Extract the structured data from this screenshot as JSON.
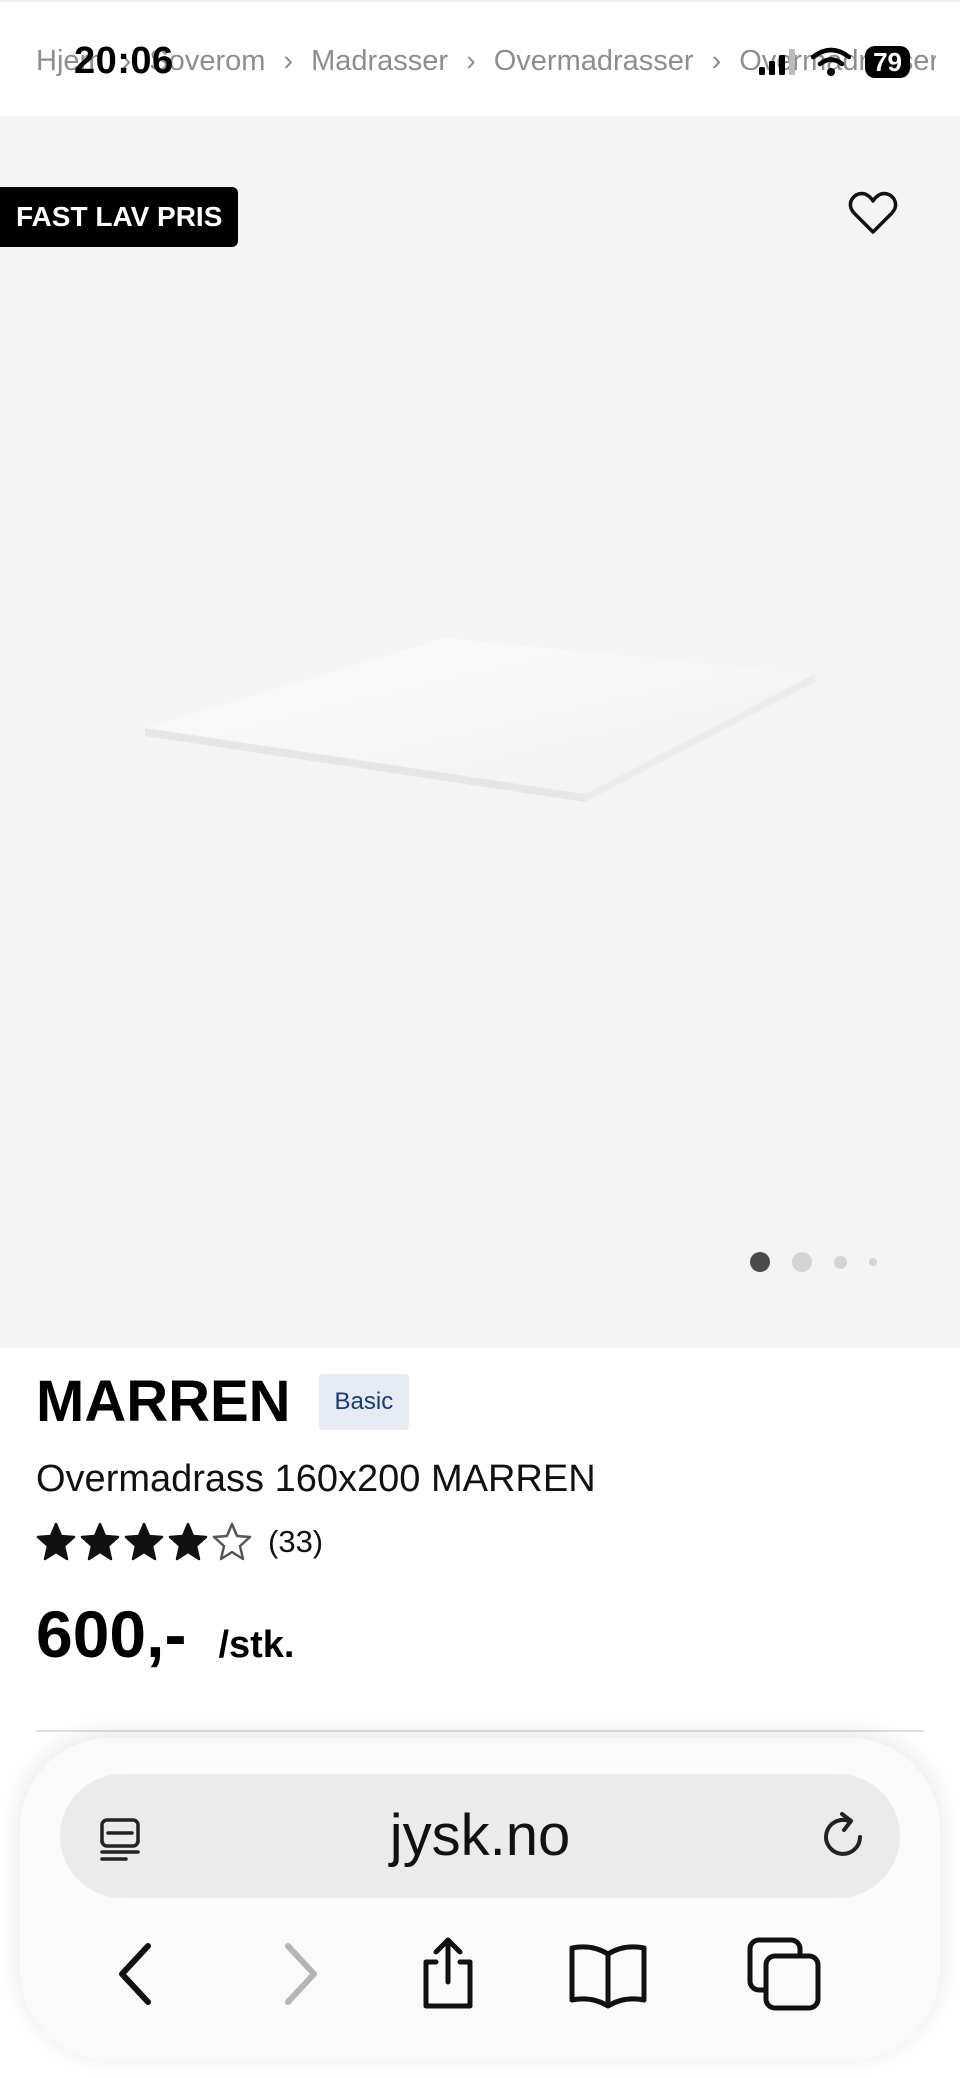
{
  "status_bar": {
    "time": "20:06",
    "battery": "79"
  },
  "breadcrumb": [
    "Hjem",
    "Soverom",
    "Madrasser",
    "Overmadrasser",
    "Overmadrasser"
  ],
  "gallery": {
    "badge": "FAST LAV PRIS",
    "current_slide": 1,
    "slide_count": 4
  },
  "product": {
    "brand": "MARREN",
    "tag": "Basic",
    "name": "Overmadrass 160x200 MARREN",
    "rating_stars": 4,
    "rating_max": 5,
    "review_count": "(33)",
    "price": "600,-",
    "unit": "/stk."
  },
  "browser": {
    "url": "jysk.no"
  },
  "icons": {
    "favorite": "heart-outline-icon",
    "reader": "reader-mode-icon",
    "reload": "reload-icon",
    "back": "chevron-left-icon",
    "forward": "chevron-right-icon",
    "share": "share-icon",
    "bookmarks": "book-icon",
    "tabs": "tabs-icon"
  }
}
